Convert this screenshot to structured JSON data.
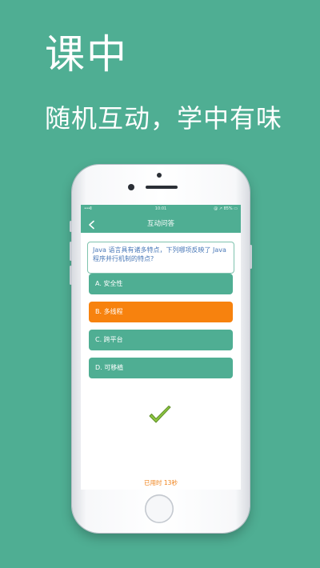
{
  "hero": {
    "title": "课中",
    "subtitle": "随机互动，学中有味"
  },
  "status_bar": {
    "signal": "•••ll",
    "time": "10:01",
    "right": "@ ↗ 85% ▭"
  },
  "nav": {
    "title": "互动问答",
    "back_icon": "chevron-left-icon"
  },
  "question": {
    "text": "Java 语言具有诸多特点，下列哪项反映了 Java 程序并行机制的特点?"
  },
  "options": [
    {
      "label": "A. 安全性",
      "selected": false
    },
    {
      "label": "B. 多线程",
      "selected": true
    },
    {
      "label": "C. 跨平台",
      "selected": false
    },
    {
      "label": "D. 可移植",
      "selected": false
    }
  ],
  "result_icon": "check-icon",
  "timer": {
    "text": "已用时 13秒"
  },
  "colors": {
    "background": "#4fae93",
    "primary": "#4fae93",
    "selected": "#f7820e",
    "question_text": "#4a79b8",
    "check": "#8dc63f",
    "timer_text": "#f0821a"
  }
}
